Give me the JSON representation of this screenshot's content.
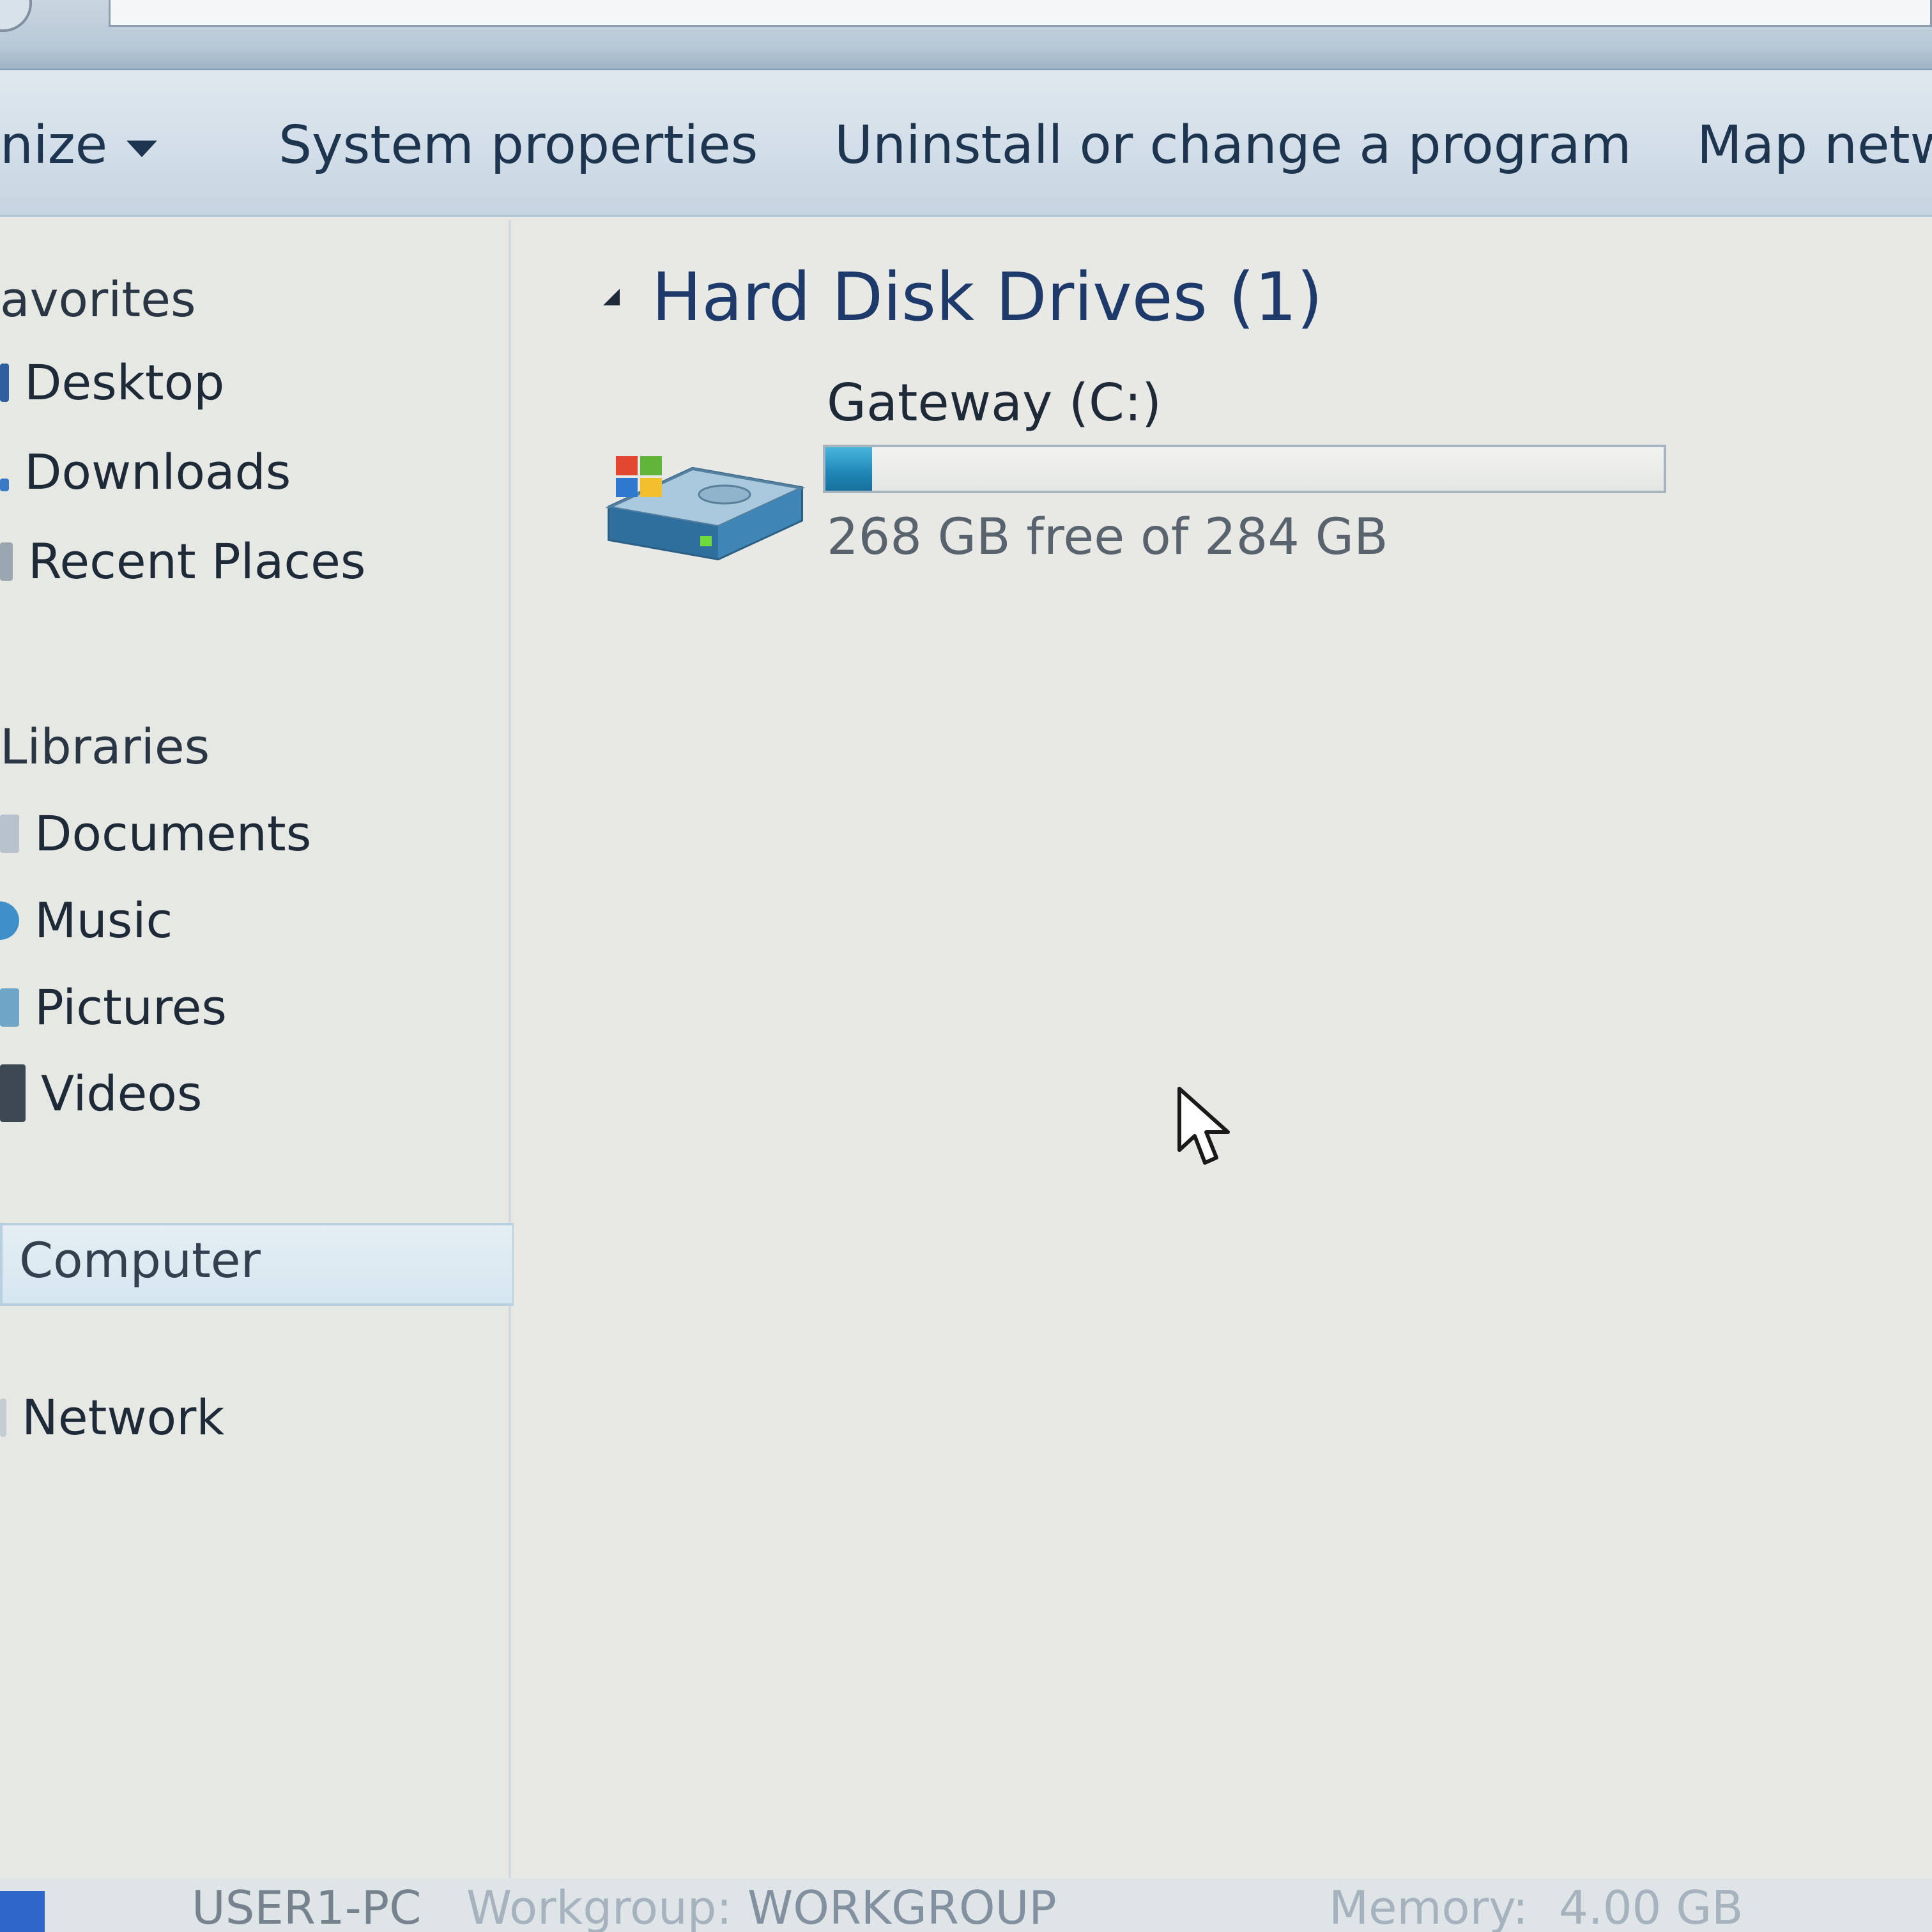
{
  "toolbar": {
    "organize_label": "nize",
    "system_properties_label": "System properties",
    "uninstall_label": "Uninstall or change a program",
    "map_network_label": "Map netw"
  },
  "nav": {
    "favorites_label": "avorites",
    "favorites_items": [
      "Desktop",
      "Downloads",
      "Recent Places"
    ],
    "libraries_label": "Libraries",
    "library_items": [
      "Documents",
      "Music",
      "Pictures",
      "Videos"
    ],
    "computer_label": "Computer",
    "network_label": "Network"
  },
  "content": {
    "group_header": "Hard Disk Drives (1)",
    "drive": {
      "name": "Gateway (C:)",
      "free_text": "268 GB free of 284 GB",
      "used_fraction": 0.056
    }
  },
  "details": {
    "computer_name": "USER1-PC",
    "workgroup_label": "Workgroup:",
    "workgroup_value": "WORKGROUP",
    "memory_label": "Memory:",
    "memory_value": "4.00 GB"
  },
  "colors": {
    "accent_blue": "#1d3a6a",
    "drive_fill": "#1f86b6"
  }
}
